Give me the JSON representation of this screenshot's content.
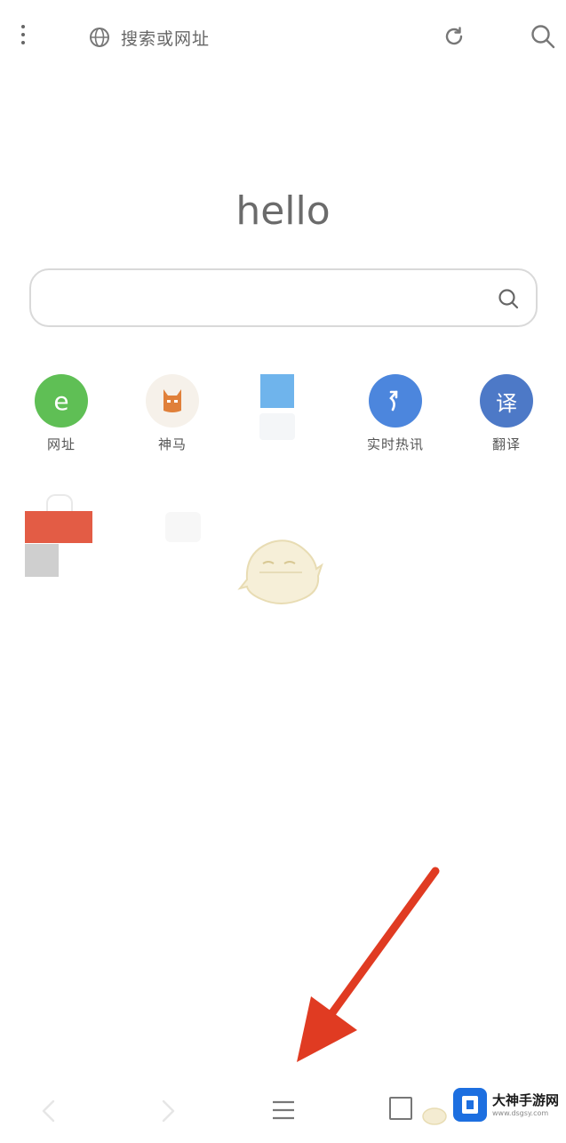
{
  "topbar": {
    "address_placeholder": "搜索或网址",
    "icons": {
      "menu": "vertical-dots-icon",
      "globe": "globe-icon",
      "refresh": "refresh-icon",
      "search": "search-icon"
    }
  },
  "home": {
    "greeting": "hello",
    "search_placeholder": ""
  },
  "shortcuts": [
    {
      "label": "网址",
      "glyph": "e",
      "color": "#5fbf55",
      "kind": "circle"
    },
    {
      "label": "神马",
      "glyph": "",
      "color": "#f6f1ea",
      "kind": "app"
    },
    {
      "label": "",
      "glyph": "",
      "color": "#6fb4ec",
      "kind": "square"
    },
    {
      "label": "实时热讯",
      "glyph": "↰",
      "color": "#4c86dd",
      "kind": "circle"
    },
    {
      "label": "翻译",
      "glyph": "译",
      "color": "#4d79c7",
      "kind": "circle"
    }
  ],
  "bottom_nav": {
    "icons": [
      "back-icon",
      "forward-icon",
      "menu-icon",
      "tabs-icon",
      "home-icon"
    ]
  },
  "watermark": {
    "name": "大神手游网",
    "url": "www.dsgsy.com"
  },
  "colors": {
    "arrow": "#e03b22",
    "accent_red": "#e35c45",
    "accent_blue": "#6fb4ec"
  }
}
